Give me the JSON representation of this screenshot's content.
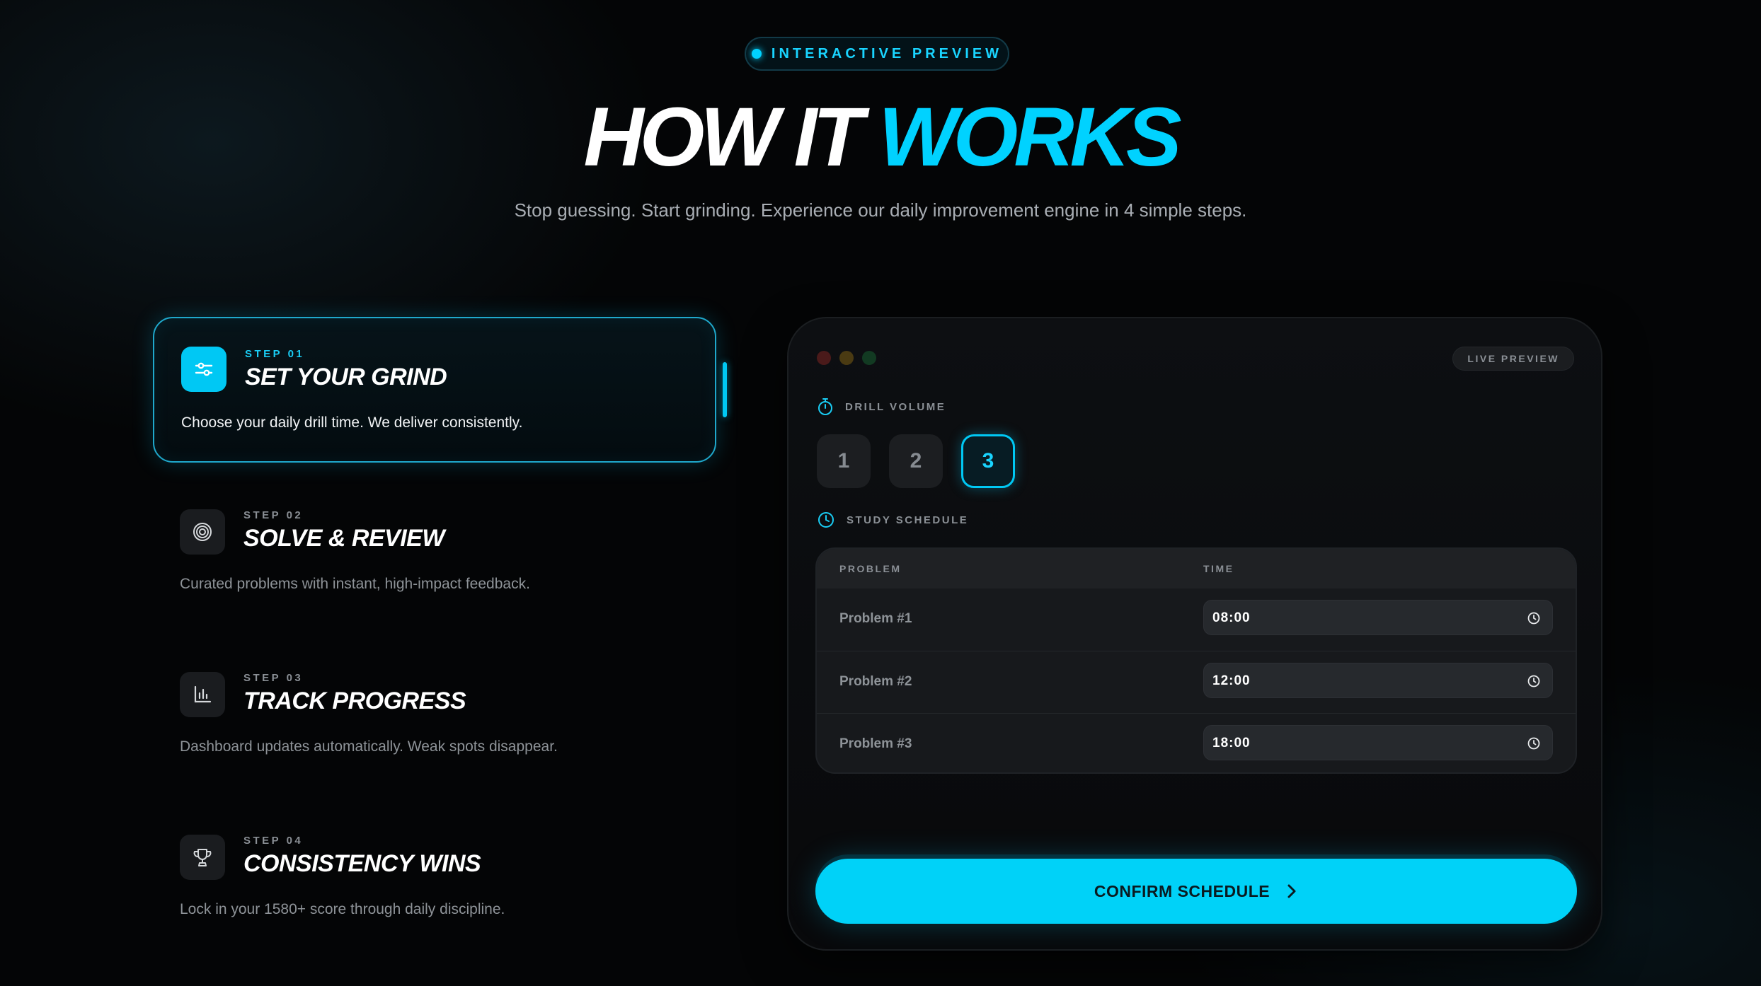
{
  "header": {
    "badge": "INTERACTIVE PREVIEW",
    "title_white": "HOW IT ",
    "title_accent": "WORKS",
    "subtitle": "Stop guessing. Start grinding. Experience our daily improvement engine in 4 simple steps."
  },
  "steps": [
    {
      "label": "STEP 01",
      "title": "SET YOUR GRIND",
      "desc": "Choose your daily drill time. We deliver consistently.",
      "icon": "sliders-icon",
      "active": true
    },
    {
      "label": "STEP 02",
      "title": "SOLVE & REVIEW",
      "desc": "Curated problems with instant, high-impact feedback.",
      "icon": "target-icon",
      "active": false
    },
    {
      "label": "STEP 03",
      "title": "TRACK PROGRESS",
      "desc": "Dashboard updates automatically. Weak spots disappear.",
      "icon": "bar-chart-icon",
      "active": false
    },
    {
      "label": "STEP 04",
      "title": "CONSISTENCY WINS",
      "desc": "Lock in your 1580+ score through daily discipline.",
      "icon": "trophy-icon",
      "active": false
    }
  ],
  "preview": {
    "live_label": "LIVE PREVIEW",
    "drill_volume_label": "DRILL VOLUME",
    "volume_options": [
      "1",
      "2",
      "3"
    ],
    "selected_volume": "3",
    "schedule_label": "STUDY SCHEDULE",
    "table": {
      "col_problem": "PROBLEM",
      "col_time": "TIME",
      "rows": [
        {
          "problem": "Problem #1",
          "time": "08:00"
        },
        {
          "problem": "Problem #2",
          "time": "12:00"
        },
        {
          "problem": "Problem #3",
          "time": "18:00"
        }
      ]
    },
    "confirm_label": "CONFIRM SCHEDULE"
  },
  "colors": {
    "accent": "#00D2FF",
    "background": "#040506",
    "window_dot_red": "#4a1a1a",
    "window_dot_yellow": "#4a3a12",
    "window_dot_green": "#123a22"
  }
}
